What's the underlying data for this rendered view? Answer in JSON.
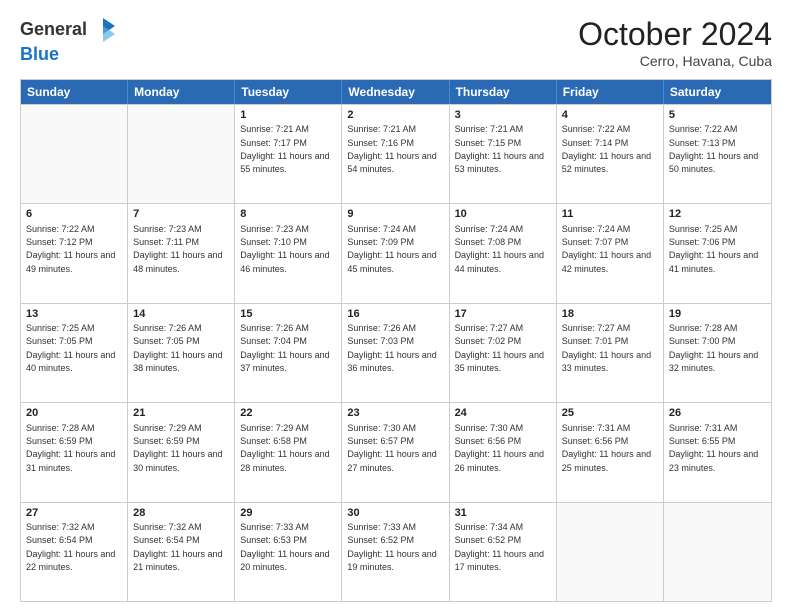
{
  "header": {
    "logo_line1": "General",
    "logo_line2": "Blue",
    "month": "October 2024",
    "location": "Cerro, Havana, Cuba"
  },
  "days_of_week": [
    "Sunday",
    "Monday",
    "Tuesday",
    "Wednesday",
    "Thursday",
    "Friday",
    "Saturday"
  ],
  "weeks": [
    [
      {
        "day": "",
        "sunrise": "",
        "sunset": "",
        "daylight": "",
        "empty": true
      },
      {
        "day": "",
        "sunrise": "",
        "sunset": "",
        "daylight": "",
        "empty": true
      },
      {
        "day": "1",
        "sunrise": "Sunrise: 7:21 AM",
        "sunset": "Sunset: 7:17 PM",
        "daylight": "Daylight: 11 hours and 55 minutes.",
        "empty": false
      },
      {
        "day": "2",
        "sunrise": "Sunrise: 7:21 AM",
        "sunset": "Sunset: 7:16 PM",
        "daylight": "Daylight: 11 hours and 54 minutes.",
        "empty": false
      },
      {
        "day": "3",
        "sunrise": "Sunrise: 7:21 AM",
        "sunset": "Sunset: 7:15 PM",
        "daylight": "Daylight: 11 hours and 53 minutes.",
        "empty": false
      },
      {
        "day": "4",
        "sunrise": "Sunrise: 7:22 AM",
        "sunset": "Sunset: 7:14 PM",
        "daylight": "Daylight: 11 hours and 52 minutes.",
        "empty": false
      },
      {
        "day": "5",
        "sunrise": "Sunrise: 7:22 AM",
        "sunset": "Sunset: 7:13 PM",
        "daylight": "Daylight: 11 hours and 50 minutes.",
        "empty": false
      }
    ],
    [
      {
        "day": "6",
        "sunrise": "Sunrise: 7:22 AM",
        "sunset": "Sunset: 7:12 PM",
        "daylight": "Daylight: 11 hours and 49 minutes.",
        "empty": false
      },
      {
        "day": "7",
        "sunrise": "Sunrise: 7:23 AM",
        "sunset": "Sunset: 7:11 PM",
        "daylight": "Daylight: 11 hours and 48 minutes.",
        "empty": false
      },
      {
        "day": "8",
        "sunrise": "Sunrise: 7:23 AM",
        "sunset": "Sunset: 7:10 PM",
        "daylight": "Daylight: 11 hours and 46 minutes.",
        "empty": false
      },
      {
        "day": "9",
        "sunrise": "Sunrise: 7:24 AM",
        "sunset": "Sunset: 7:09 PM",
        "daylight": "Daylight: 11 hours and 45 minutes.",
        "empty": false
      },
      {
        "day": "10",
        "sunrise": "Sunrise: 7:24 AM",
        "sunset": "Sunset: 7:08 PM",
        "daylight": "Daylight: 11 hours and 44 minutes.",
        "empty": false
      },
      {
        "day": "11",
        "sunrise": "Sunrise: 7:24 AM",
        "sunset": "Sunset: 7:07 PM",
        "daylight": "Daylight: 11 hours and 42 minutes.",
        "empty": false
      },
      {
        "day": "12",
        "sunrise": "Sunrise: 7:25 AM",
        "sunset": "Sunset: 7:06 PM",
        "daylight": "Daylight: 11 hours and 41 minutes.",
        "empty": false
      }
    ],
    [
      {
        "day": "13",
        "sunrise": "Sunrise: 7:25 AM",
        "sunset": "Sunset: 7:05 PM",
        "daylight": "Daylight: 11 hours and 40 minutes.",
        "empty": false
      },
      {
        "day": "14",
        "sunrise": "Sunrise: 7:26 AM",
        "sunset": "Sunset: 7:05 PM",
        "daylight": "Daylight: 11 hours and 38 minutes.",
        "empty": false
      },
      {
        "day": "15",
        "sunrise": "Sunrise: 7:26 AM",
        "sunset": "Sunset: 7:04 PM",
        "daylight": "Daylight: 11 hours and 37 minutes.",
        "empty": false
      },
      {
        "day": "16",
        "sunrise": "Sunrise: 7:26 AM",
        "sunset": "Sunset: 7:03 PM",
        "daylight": "Daylight: 11 hours and 36 minutes.",
        "empty": false
      },
      {
        "day": "17",
        "sunrise": "Sunrise: 7:27 AM",
        "sunset": "Sunset: 7:02 PM",
        "daylight": "Daylight: 11 hours and 35 minutes.",
        "empty": false
      },
      {
        "day": "18",
        "sunrise": "Sunrise: 7:27 AM",
        "sunset": "Sunset: 7:01 PM",
        "daylight": "Daylight: 11 hours and 33 minutes.",
        "empty": false
      },
      {
        "day": "19",
        "sunrise": "Sunrise: 7:28 AM",
        "sunset": "Sunset: 7:00 PM",
        "daylight": "Daylight: 11 hours and 32 minutes.",
        "empty": false
      }
    ],
    [
      {
        "day": "20",
        "sunrise": "Sunrise: 7:28 AM",
        "sunset": "Sunset: 6:59 PM",
        "daylight": "Daylight: 11 hours and 31 minutes.",
        "empty": false
      },
      {
        "day": "21",
        "sunrise": "Sunrise: 7:29 AM",
        "sunset": "Sunset: 6:59 PM",
        "daylight": "Daylight: 11 hours and 30 minutes.",
        "empty": false
      },
      {
        "day": "22",
        "sunrise": "Sunrise: 7:29 AM",
        "sunset": "Sunset: 6:58 PM",
        "daylight": "Daylight: 11 hours and 28 minutes.",
        "empty": false
      },
      {
        "day": "23",
        "sunrise": "Sunrise: 7:30 AM",
        "sunset": "Sunset: 6:57 PM",
        "daylight": "Daylight: 11 hours and 27 minutes.",
        "empty": false
      },
      {
        "day": "24",
        "sunrise": "Sunrise: 7:30 AM",
        "sunset": "Sunset: 6:56 PM",
        "daylight": "Daylight: 11 hours and 26 minutes.",
        "empty": false
      },
      {
        "day": "25",
        "sunrise": "Sunrise: 7:31 AM",
        "sunset": "Sunset: 6:56 PM",
        "daylight": "Daylight: 11 hours and 25 minutes.",
        "empty": false
      },
      {
        "day": "26",
        "sunrise": "Sunrise: 7:31 AM",
        "sunset": "Sunset: 6:55 PM",
        "daylight": "Daylight: 11 hours and 23 minutes.",
        "empty": false
      }
    ],
    [
      {
        "day": "27",
        "sunrise": "Sunrise: 7:32 AM",
        "sunset": "Sunset: 6:54 PM",
        "daylight": "Daylight: 11 hours and 22 minutes.",
        "empty": false
      },
      {
        "day": "28",
        "sunrise": "Sunrise: 7:32 AM",
        "sunset": "Sunset: 6:54 PM",
        "daylight": "Daylight: 11 hours and 21 minutes.",
        "empty": false
      },
      {
        "day": "29",
        "sunrise": "Sunrise: 7:33 AM",
        "sunset": "Sunset: 6:53 PM",
        "daylight": "Daylight: 11 hours and 20 minutes.",
        "empty": false
      },
      {
        "day": "30",
        "sunrise": "Sunrise: 7:33 AM",
        "sunset": "Sunset: 6:52 PM",
        "daylight": "Daylight: 11 hours and 19 minutes.",
        "empty": false
      },
      {
        "day": "31",
        "sunrise": "Sunrise: 7:34 AM",
        "sunset": "Sunset: 6:52 PM",
        "daylight": "Daylight: 11 hours and 17 minutes.",
        "empty": false
      },
      {
        "day": "",
        "sunrise": "",
        "sunset": "",
        "daylight": "",
        "empty": true
      },
      {
        "day": "",
        "sunrise": "",
        "sunset": "",
        "daylight": "",
        "empty": true
      }
    ]
  ]
}
